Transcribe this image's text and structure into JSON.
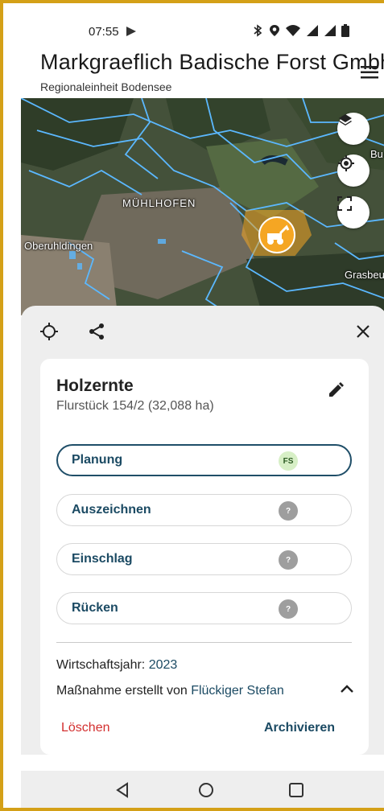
{
  "status_bar": {
    "time": "07:55"
  },
  "header": {
    "title": "Markgraeflich Badische Forst Gmbh",
    "subtitle": "Regionaleinheit Bodensee"
  },
  "map": {
    "labels": [
      "MÜHLHOFEN",
      "Oberuhldingen",
      "Grasbeu",
      "Bu"
    ],
    "accent_outline": "#5bb8ff",
    "marker_color": "#f5a623"
  },
  "sheet": {
    "card": {
      "title": "Holzernte",
      "subtitle": "Flurstück 154/2 (32,088 ha)",
      "steps": [
        {
          "label": "Planung",
          "badge": "FS",
          "active": true
        },
        {
          "label": "Auszeichnen",
          "badge": "?",
          "active": false
        },
        {
          "label": "Einschlag",
          "badge": "?",
          "active": false
        },
        {
          "label": "Rücken",
          "badge": "?",
          "active": false
        }
      ],
      "year_label": "Wirtschaftsjahr:",
      "year_value": "2023",
      "created_label": "Maßnahme erstellt von",
      "created_by": "Flückiger Stefan",
      "delete_label": "Löschen",
      "archive_label": "Archivieren"
    }
  },
  "colors": {
    "primary": "#1b4a63",
    "danger": "#d32f2f",
    "frame": "#d4a017"
  }
}
